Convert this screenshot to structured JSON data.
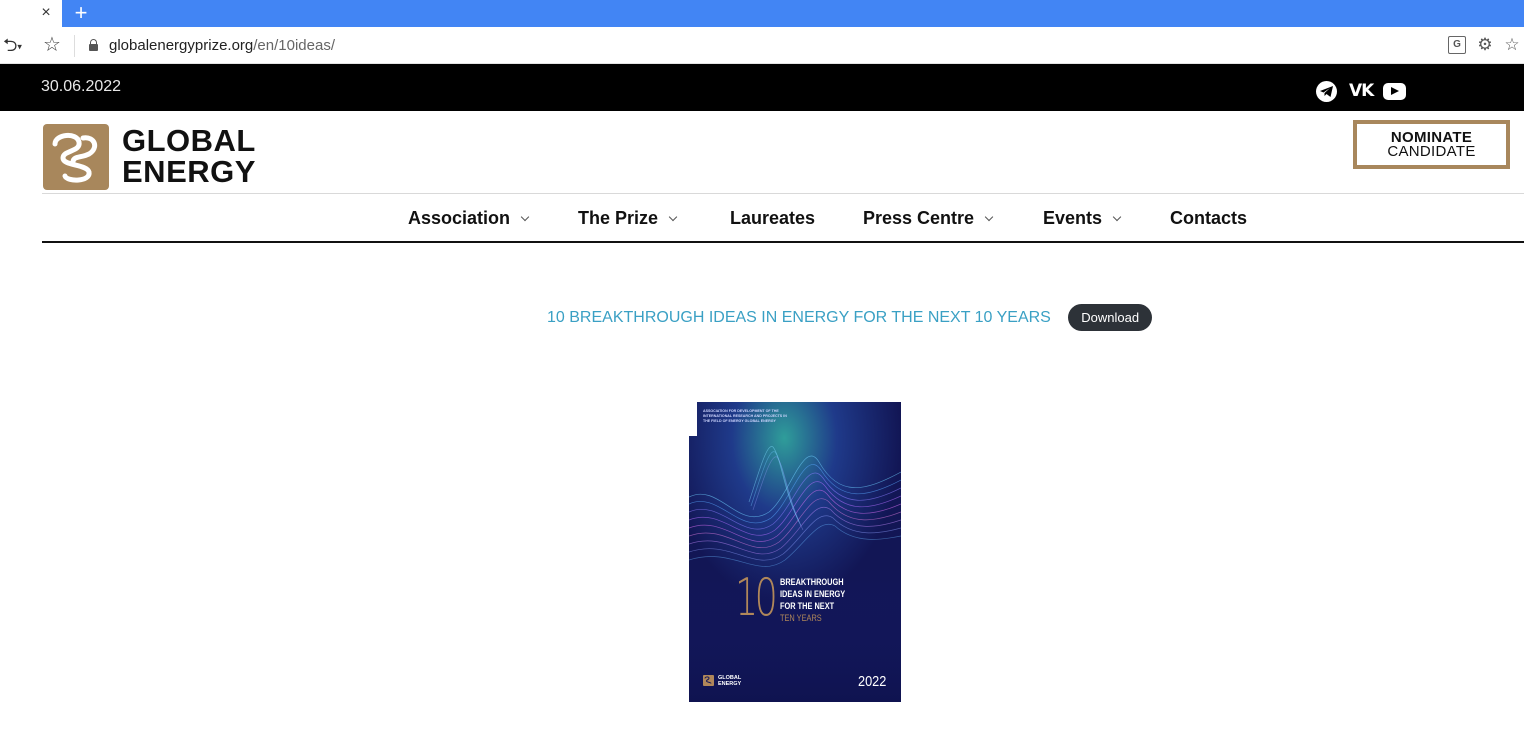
{
  "browser": {
    "close_glyph": "×",
    "new_tab_glyph": "+",
    "back_glyph": "⮌",
    "star_glyph": "☆",
    "url_host": "globalenergyprize.org",
    "url_path": "/en/10ideas/",
    "icons": [
      "close-icon",
      "plus-icon",
      "undo-icon",
      "star-icon",
      "lock-icon",
      "translate-icon",
      "extension-icon",
      "add-favorite-icon"
    ]
  },
  "topbar": {
    "date": "30.06.2022",
    "social": {
      "vk_glyph": "VK",
      "icons": [
        "telegram-icon",
        "vk-icon",
        "youtube-icon"
      ]
    }
  },
  "header": {
    "logo_line1": "GLOBAL",
    "logo_line2": "ENERGY",
    "nominate_line1": "NOMINATE",
    "nominate_line2": "CANDIDATE",
    "brand_gold": "#a8875c"
  },
  "nav": {
    "items": [
      {
        "label": "Association",
        "dropdown": true
      },
      {
        "label": "The Prize",
        "dropdown": true
      },
      {
        "label": "Laureates",
        "dropdown": false
      },
      {
        "label": "Press Centre",
        "dropdown": true
      },
      {
        "label": "Events",
        "dropdown": true
      },
      {
        "label": "Contacts",
        "dropdown": false
      }
    ]
  },
  "content": {
    "title": "10 BREAKTHROUGH IDEAS IN ENERGY FOR THE NEXT 10 YEARS",
    "download_label": "Download",
    "title_color": "#3aa0c4",
    "cover": {
      "top_text": "Association for Development of the International Research and Projects in the Field of Energy Global Energy",
      "big_number": "10",
      "headline_l1": "BREAKTHROUGH",
      "headline_l2": "IDEAS IN ENERGY",
      "headline_l3": "FOR THE NEXT",
      "headline_l4": "TEN YEARS",
      "logo_l1": "GLOBAL",
      "logo_l2": "ENERGY",
      "year": "2022"
    }
  }
}
